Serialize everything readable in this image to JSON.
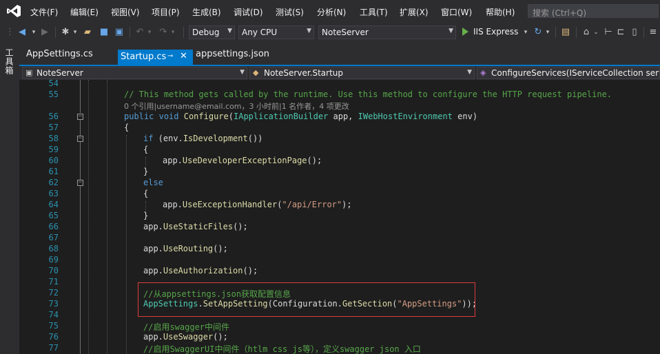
{
  "menu": [
    "文件(F)",
    "编辑(E)",
    "视图(V)",
    "项目(P)",
    "生成(B)",
    "调试(D)",
    "测试(S)",
    "分析(N)",
    "工具(T)",
    "扩展(X)",
    "窗口(W)",
    "帮助(H)"
  ],
  "search": {
    "placeholder": "搜索 (Ctrl+Q)"
  },
  "toolbar": {
    "config": "Debug",
    "platform": "Any CPU",
    "startup_project": "NoteServer",
    "run_target": "IIS Express"
  },
  "side_toolbox": "工具箱",
  "tabs": [
    {
      "label": "AppSettings.cs",
      "active": false
    },
    {
      "label": "Startup.cs",
      "active": true
    },
    {
      "label": "appsettings.json",
      "active": false
    }
  ],
  "nav": {
    "project": "NoteServer",
    "class": "NoteServer.Startup",
    "member": "ConfigureServices(IServiceCollection services)"
  },
  "code_lines": [
    {
      "n": "54",
      "text": ""
    },
    {
      "n": "55",
      "text": "// This method gets called by the runtime. Use this method to configure the HTTP request pipeline."
    },
    {
      "n": "",
      "text": "0 个引用|username@email.com，3 小时前|1 名作者，4 项更改"
    },
    {
      "n": "56",
      "text": "public void Configure(IApplicationBuilder app, IWebHostEnvironment env)"
    },
    {
      "n": "57",
      "text": "{"
    },
    {
      "n": "58",
      "text": "if (env.IsDevelopment())"
    },
    {
      "n": "59",
      "text": "{"
    },
    {
      "n": "60",
      "text": "app.UseDeveloperExceptionPage();"
    },
    {
      "n": "61",
      "text": "}"
    },
    {
      "n": "62",
      "text": "else"
    },
    {
      "n": "63",
      "text": "{"
    },
    {
      "n": "64",
      "text": "app.UseExceptionHandler(\"/api/Error\");"
    },
    {
      "n": "65",
      "text": "}"
    },
    {
      "n": "66",
      "text": "app.UseStaticFiles();"
    },
    {
      "n": "67",
      "text": ""
    },
    {
      "n": "68",
      "text": "app.UseRouting();"
    },
    {
      "n": "69",
      "text": ""
    },
    {
      "n": "70",
      "text": "app.UseAuthorization();"
    },
    {
      "n": "71",
      "text": ""
    },
    {
      "n": "72",
      "text": "//从appsettings.json获取配置信息"
    },
    {
      "n": "73",
      "text": "AppSettings.SetAppSetting(Configuration.GetSection(\"AppSettings\"));"
    },
    {
      "n": "74",
      "text": ""
    },
    {
      "n": "75",
      "text": "//启用swagger中间件"
    },
    {
      "n": "76",
      "text": "app.UseSwagger();"
    },
    {
      "n": "77",
      "text": "//启用SwaggerUI中间件（htlm css js等），定义swagger json 入口"
    }
  ],
  "colors": {
    "accent": "#007acc",
    "keyword": "#569cd6",
    "type": "#4ec9b0",
    "comment": "#57a64a",
    "string": "#d69d85",
    "method": "#dcdcaa",
    "line_number": "#2b91af",
    "highlight_box": "#e03c3c"
  }
}
